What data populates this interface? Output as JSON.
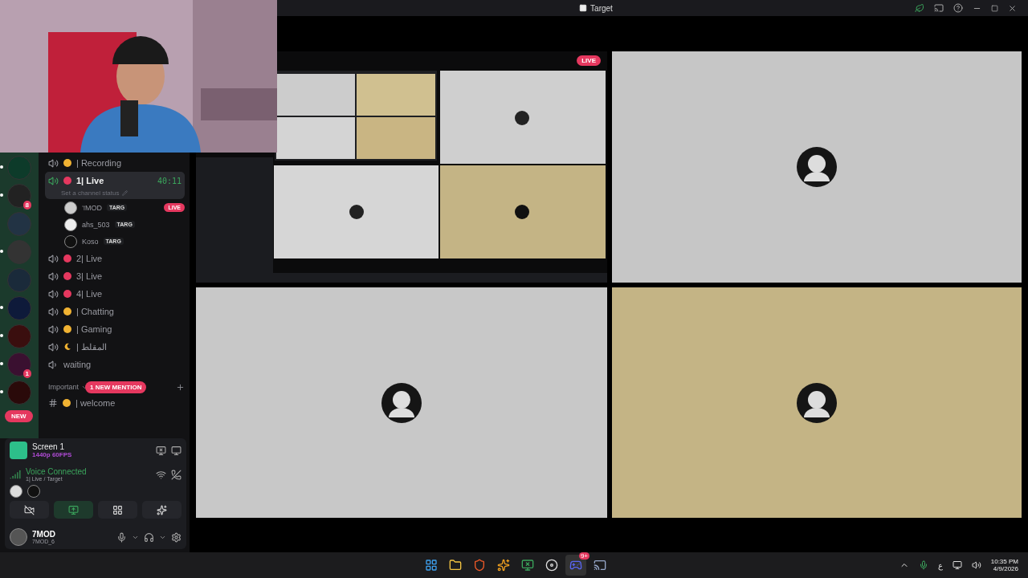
{
  "window": {
    "title": "Target"
  },
  "servers": [
    {
      "unread": true
    },
    {
      "unread": true,
      "badge": "8"
    },
    {
      "unread": false
    },
    {
      "unread": true
    },
    {
      "unread": false
    },
    {
      "unread": true
    },
    {
      "unread": true
    },
    {
      "unread": true,
      "badge": "1"
    },
    {
      "unread": true
    }
  ],
  "new_badge": "NEW",
  "channels": [
    {
      "kind": "status-voice",
      "name": "| Recording",
      "color": "#f0b232",
      "selected": false
    },
    {
      "kind": "status-voice",
      "name": "1| Live",
      "color": "#e5385f",
      "selected": true,
      "timer": "40:11",
      "status": "Set a channel status",
      "users": [
        {
          "name": "ℸMOD",
          "tag": "TARG",
          "badge": "LIVE"
        },
        {
          "name": "ahs_503",
          "tag": "TARG"
        },
        {
          "name": "Koso",
          "tag": "TARG"
        }
      ]
    },
    {
      "kind": "status-voice",
      "name": "2| Live",
      "color": "#e5385f",
      "selected": false
    },
    {
      "kind": "status-voice",
      "name": "3| Live",
      "color": "#e5385f",
      "selected": false
    },
    {
      "kind": "status-voice",
      "name": "4| Live",
      "color": "#e5385f",
      "selected": false
    },
    {
      "kind": "status-voice",
      "name": "| Chatting",
      "color": "#f0b232",
      "selected": false
    },
    {
      "kind": "status-voice",
      "name": "| Gaming",
      "color": "#f0b232",
      "selected": false
    },
    {
      "kind": "moon-voice",
      "name": "| المقلط",
      "selected": false
    },
    {
      "kind": "voice",
      "name": "waiting",
      "selected": false
    }
  ],
  "category": {
    "name": "Important",
    "mention": "1 NEW MENTION"
  },
  "text_channel": {
    "name": "| welcome"
  },
  "stream": {
    "title": "Screen 1",
    "quality": "1440p 60FPS"
  },
  "voice": {
    "state": "Voice Connected",
    "channel": "1| Live / Target"
  },
  "user": {
    "name": "7MOD",
    "subtitle": "7MOD_6"
  },
  "tiles": [
    {
      "kind": "stream",
      "badge": "LIVE"
    },
    {
      "kind": "avatar",
      "color": "#c6c6c6"
    },
    {
      "kind": "avatar",
      "color": "#c8c8c8"
    },
    {
      "kind": "avatar",
      "color": "#c4b485"
    }
  ],
  "taskbar": {
    "apps": [
      {
        "selected": false
      },
      {
        "selected": false
      },
      {
        "selected": false
      },
      {
        "selected": false
      },
      {
        "selected": false
      },
      {
        "selected": false
      },
      {
        "selected": true,
        "badge": "9+"
      },
      {
        "selected": false
      }
    ],
    "language": "ع",
    "time": "10:35 PM",
    "date": "4/9/2026"
  }
}
